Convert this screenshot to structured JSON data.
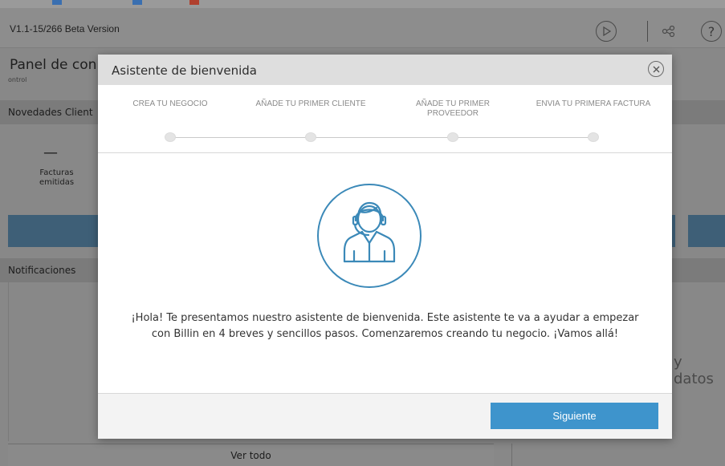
{
  "app": {
    "version": "V1.1-15/266 Beta Version"
  },
  "header": {
    "icons": [
      "play-icon",
      "share-icon",
      "help-icon"
    ],
    "help_glyph": "?"
  },
  "background": {
    "page_title": "Panel de con",
    "page_subtitle": "ontrol",
    "news_section": "Novedades Client",
    "metric_value": "—",
    "metric_label": "Facturas emitidas",
    "notifications_section": "Notificaciones",
    "partial_text": "y datos",
    "see_all": "Ver todo"
  },
  "modal": {
    "title": "Asistente de bienvenida",
    "steps": [
      {
        "label": "CREA TU NEGOCIO"
      },
      {
        "label": "AÑADE TU PRIMER CLIENTE"
      },
      {
        "label": "AÑADE TU PRIMER PROVEEDOR"
      },
      {
        "label": "ENVIA TU PRIMERA FACTURA"
      }
    ],
    "intro_text": "¡Hola! Te presentamos nuestro asistente de bienvenida. Este asistente te va a ayudar a empezar con Billin en 4 breves y sencillos pasos. Comenzaremos creando tu negocio. ¡Vamos allá!",
    "next_button": "Siguiente"
  },
  "colors": {
    "accent": "#3e94cc",
    "avatar_stroke": "#3b89b8",
    "overlay": "#8f8f8f"
  }
}
